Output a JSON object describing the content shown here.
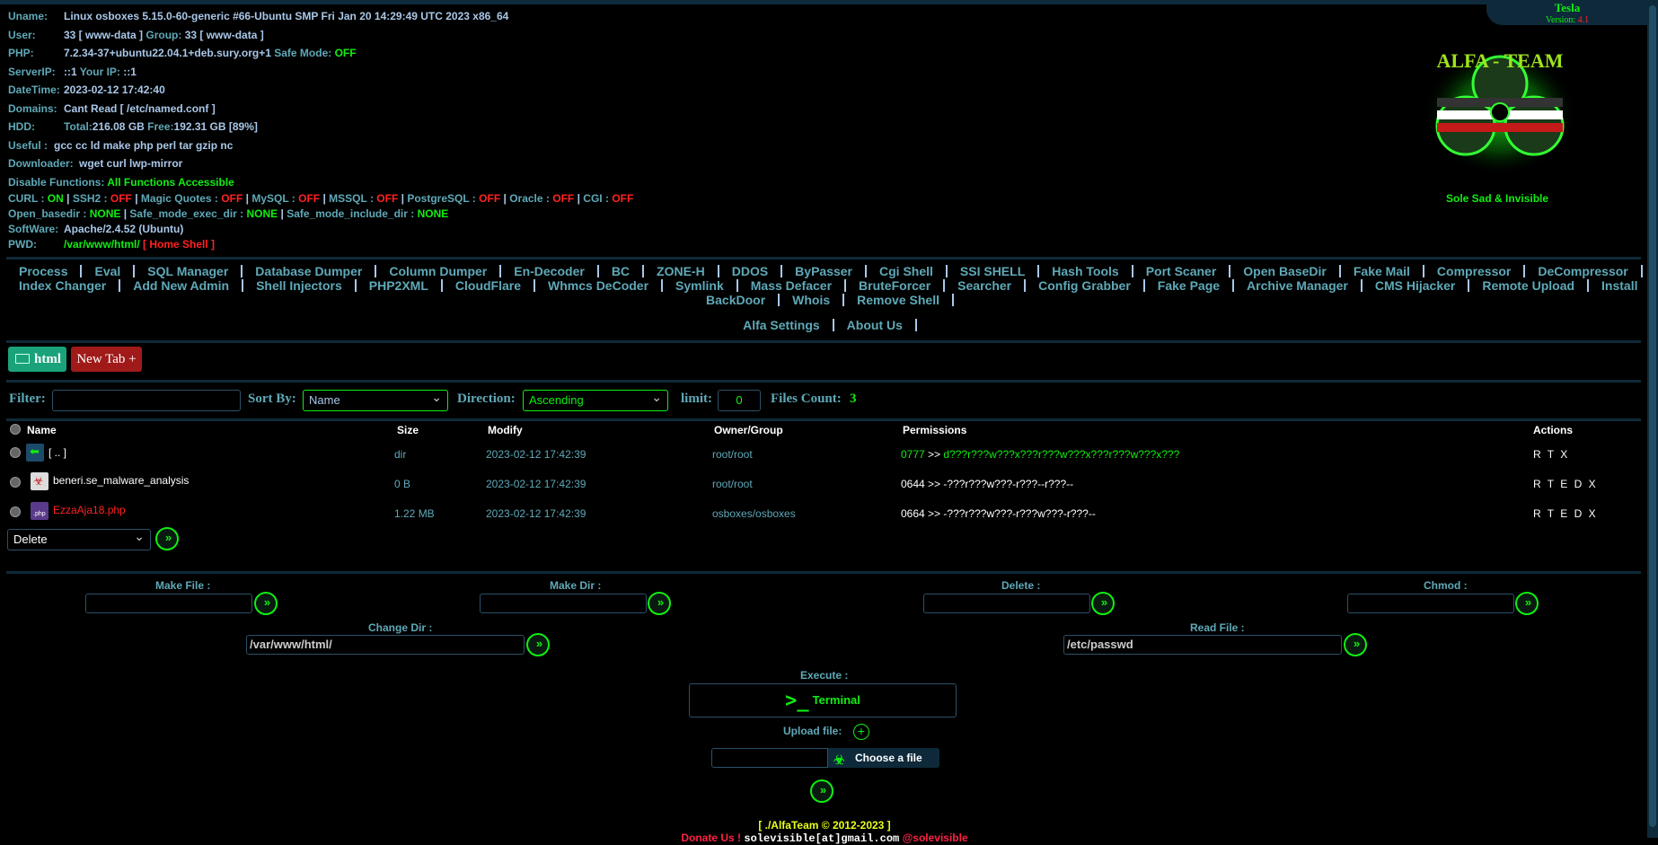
{
  "server_info": {
    "uname_label": "Uname:",
    "uname": "Linux osboxes 5.15.0-60-generic #66-Ubuntu SMP Fri Jan 20 14:29:49 UTC 2023 x86_64",
    "user_label": "User:",
    "user": "33 [ www-data ]",
    "group_label": "Group:",
    "group": "33 [ www-data ]",
    "php_label": "PHP:",
    "php": "7.2.34-37+ubuntu22.04.1+deb.sury.org+1",
    "safe_mode_label": "Safe Mode:",
    "safe_mode": "OFF",
    "serverip_label": "ServerIP:",
    "serverip": "::1",
    "yourip_label": "Your IP:",
    "yourip": "::1",
    "datetime_label": "DateTime:",
    "datetime": "2023-02-12 17:42:40",
    "domains_label": "Domains:",
    "domains": "Cant Read [ /etc/named.conf ]",
    "hdd_label": "HDD:",
    "hdd_total_label": "Total:",
    "hdd_total": "216.08 GB",
    "hdd_free_label": "Free:",
    "hdd_free": "192.31 GB [89%]",
    "useful_label": "Useful :",
    "useful": "gcc cc ld make php perl tar gzip nc",
    "downloader_label": "Downloader:",
    "downloader": "wget curl lwp-mirror",
    "disable_label": "Disable Functions:",
    "disable": "All Functions Accessible",
    "curl_label": "CURL :",
    "curl": "ON",
    "ssh2_label": "SSH2 :",
    "ssh2": "OFF",
    "magic_label": "Magic Quotes :",
    "magic": "OFF",
    "mysql_label": "MySQL :",
    "mysql": "OFF",
    "mssql_label": "MSSQL :",
    "mssql": "OFF",
    "pgsql_label": "PostgreSQL :",
    "pgsql": "OFF",
    "oracle_label": "Oracle :",
    "oracle": "OFF",
    "cgi_label": "CGI :",
    "cgi": "OFF",
    "basedir_label": "Open_basedir :",
    "basedir": "NONE",
    "execdir_label": "Safe_mode_exec_dir :",
    "execdir": "NONE",
    "includedir_label": "Safe_mode_include_dir :",
    "includedir": "NONE",
    "software_label": "SoftWare:",
    "software": "Apache/2.4.52 (Ubuntu)",
    "pwd_label": "PWD:",
    "pwd": "/var/www/html/",
    "home_shell": "[ Home Shell ]"
  },
  "branding": {
    "tesla": "Tesla",
    "version_label": "Version:",
    "version": "4.1",
    "logo_text": "ALFA - TEAM",
    "tagline": "Sole Sad & Invisible"
  },
  "menu": {
    "line1": [
      "Process",
      "Eval",
      "SQL Manager",
      "Database Dumper",
      "Column Dumper",
      "En-Decoder",
      "BC",
      "ZONE-H",
      "DDOS",
      "ByPasser",
      "Cgi Shell",
      "SSI SHELL",
      "Hash Tools",
      "Port Scaner",
      "Open BaseDir",
      "Fake Mail",
      "Compressor",
      "DeCompressor"
    ],
    "line2": [
      "Index Changer",
      "Add New Admin",
      "Shell Injectors",
      "PHP2XML",
      "CloudFlare",
      "Whmcs DeCoder",
      "Symlink",
      "Mass Defacer",
      "BruteForcer",
      "Searcher",
      "Config Grabber",
      "Fake Page",
      "Archive Manager",
      "CMS Hijacker",
      "Remote Upload",
      "Install"
    ],
    "line3": [
      "BackDoor",
      "Whois",
      "Remove Shell"
    ],
    "line4": [
      "Alfa Settings",
      "About Us"
    ]
  },
  "tabs": {
    "current": "html",
    "new_tab": "New Tab +"
  },
  "filter": {
    "filter_label": "Filter:",
    "filter_value": "",
    "sort_label": "Sort By:",
    "sort_value": "Name",
    "direction_label": "Direction:",
    "direction_value": "Ascending",
    "limit_label": "limit:",
    "limit_value": "0",
    "count_label": "Files Count:",
    "count_value": "3"
  },
  "table": {
    "headers": {
      "name": "Name",
      "size": "Size",
      "modify": "Modify",
      "owner": "Owner/Group",
      "perms": "Permissions",
      "actions": "Actions"
    },
    "rows": [
      {
        "name": "[ .. ]",
        "size": "dir",
        "modify": "2023-02-12 17:42:39",
        "owner": "root/root",
        "perm_num": "0777",
        "perm_str": "d???r???w???x???r???w???x???r???w???x???",
        "actions": "R T X"
      },
      {
        "name": "beneri.se_malware_analysis",
        "size": "0 B",
        "modify": "2023-02-12 17:42:39",
        "owner": "root/root",
        "perm_num": "0644",
        "perm_str": "-???r???w???-r???--r???--",
        "actions": "R T E D X"
      },
      {
        "name": "EzzaAja18.php",
        "size": "1.22 MB",
        "modify": "2023-02-12 17:42:39",
        "owner": "osboxes/osboxes",
        "perm_num": "0664",
        "perm_str": "-???r???w???-r???w???-r???--",
        "actions": "R T E D X"
      }
    ],
    "arrow": ">>",
    "bulk_action": "Delete"
  },
  "tools": {
    "make_file_label": "Make File :",
    "make_dir_label": "Make Dir :",
    "delete_label": "Delete :",
    "chmod_label": "Chmod :",
    "change_dir_label": "Change Dir :",
    "change_dir_value": "/var/www/html/",
    "read_file_label": "Read File :",
    "read_file_value": "/etc/passwd",
    "execute_label": "Execute :",
    "terminal": "Terminal",
    "upload_label": "Upload file:",
    "choose_file": "Choose a file",
    "go": "»"
  },
  "footer": {
    "copyright": "[ ./AlfaTeam © 2012-2023 ]",
    "donate": "Donate Us !",
    "email": "solevisible[at]gmail.com",
    "handle": "@solevisible"
  }
}
